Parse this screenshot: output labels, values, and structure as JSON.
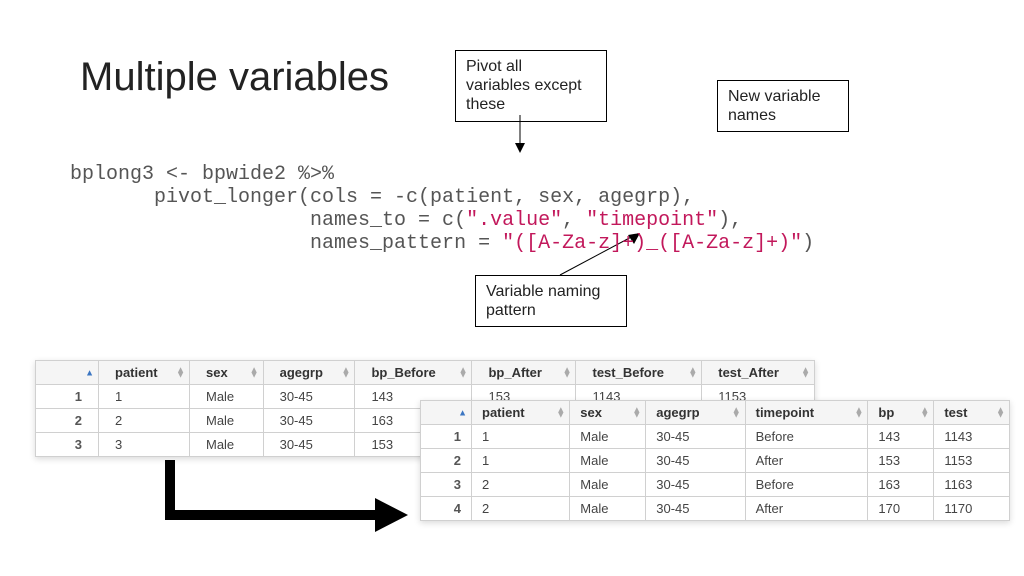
{
  "title": "Multiple variables",
  "callouts": {
    "pivot": "Pivot all\nvariables except\nthese",
    "newvars": "New variable\nnames",
    "pattern": "Variable naming\npattern"
  },
  "code": {
    "l1a": "bplong3 <- bpwide2 %>%",
    "l2a": "       pivot_longer(cols = -c(patient, sex, agegrp),",
    "l3a": "                    names_to = c(",
    "l3s1": "\".value\"",
    "l3b": ", ",
    "l3s2": "\"timepoint\"",
    "l3c": "),",
    "l4a": "                    names_pattern = ",
    "l4s": "\"([A-Za-z]+)_([A-Za-z]+)\"",
    "l4b": ")"
  },
  "t1": {
    "headers": [
      "patient",
      "sex",
      "agegrp",
      "bp_Before",
      "bp_After",
      "test_Before",
      "test_After"
    ],
    "rows": [
      [
        "1",
        "1",
        "Male",
        "30-45",
        "143",
        "153",
        "1143",
        "1153"
      ],
      [
        "2",
        "2",
        "Male",
        "30-45",
        "163",
        "",
        "",
        ""
      ],
      [
        "3",
        "3",
        "Male",
        "30-45",
        "153",
        "",
        "",
        ""
      ]
    ]
  },
  "t2": {
    "headers": [
      "patient",
      "sex",
      "agegrp",
      "timepoint",
      "bp",
      "test"
    ],
    "rows": [
      [
        "1",
        "1",
        "Male",
        "30-45",
        "Before",
        "143",
        "1143"
      ],
      [
        "2",
        "1",
        "Male",
        "30-45",
        "After",
        "153",
        "1153"
      ],
      [
        "3",
        "2",
        "Male",
        "30-45",
        "Before",
        "163",
        "1163"
      ],
      [
        "4",
        "2",
        "Male",
        "30-45",
        "After",
        "170",
        "1170"
      ]
    ]
  }
}
